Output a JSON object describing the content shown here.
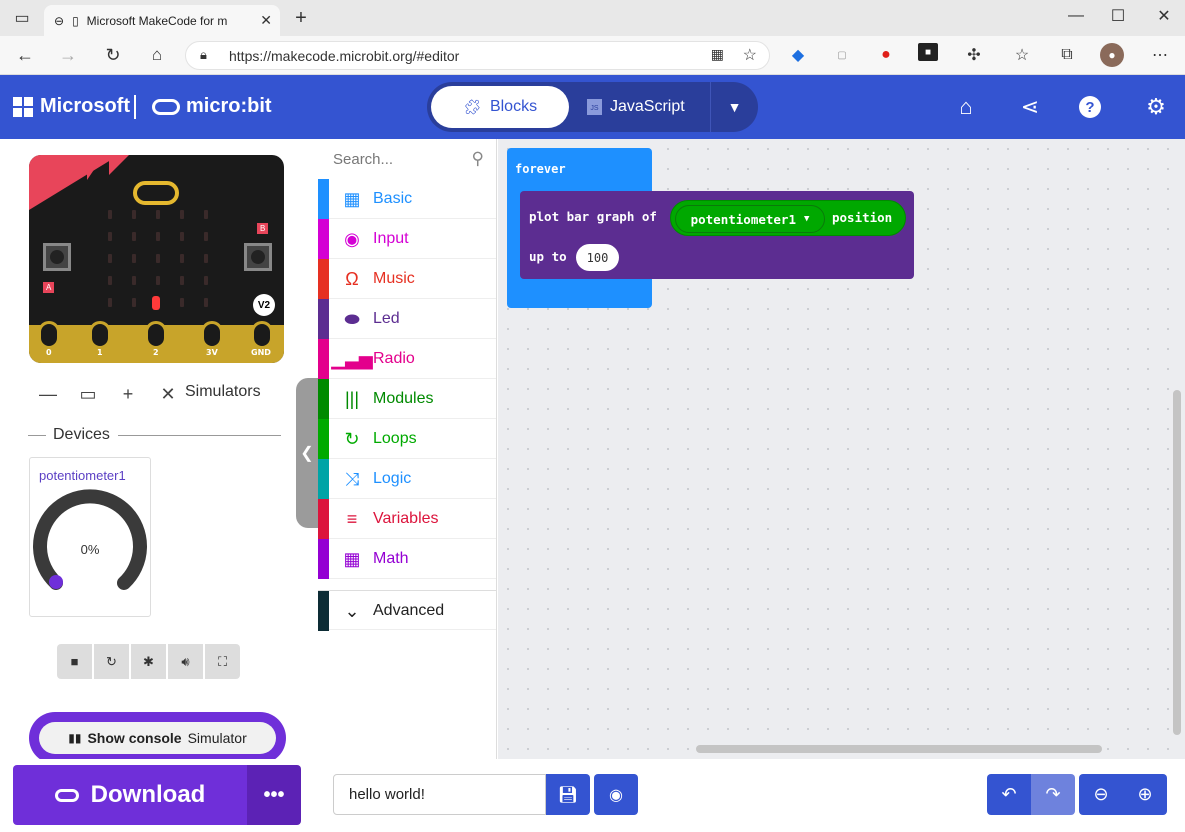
{
  "browser": {
    "tab_title": "Microsoft MakeCode for mi",
    "url": "https://makecode.microbit.org/#editor"
  },
  "header": {
    "brand": "Microsoft",
    "product": "micro:bit",
    "mode_blocks": "Blocks",
    "mode_js": "JavaScript"
  },
  "simulator": {
    "pins": [
      "0",
      "1",
      "2",
      "3V",
      "GND"
    ],
    "button_a": "A",
    "button_b": "B",
    "version_badge": "V2",
    "title": "Simulators",
    "devices_label": "Devices",
    "device_name": "potentiometer1",
    "device_value": "0%",
    "console_show": "Show console",
    "console_target": "Simulator"
  },
  "toolbox": {
    "search_placeholder": "Search...",
    "categories": [
      {
        "label": "Basic",
        "color": "#1e90ff",
        "icon": "grid-icon"
      },
      {
        "label": "Input",
        "color": "#d400d4",
        "icon": "target-icon"
      },
      {
        "label": "Music",
        "color": "#e63022",
        "icon": "headphones-icon"
      },
      {
        "label": "Led",
        "color": "#5c2d91",
        "icon": "toggle-icon"
      },
      {
        "label": "Radio",
        "color": "#e3008c",
        "icon": "signal-icon"
      },
      {
        "label": "Modules",
        "color": "#008a00",
        "icon": "modules-icon"
      },
      {
        "label": "Loops",
        "color": "#00aa00",
        "icon": "loop-icon"
      },
      {
        "label": "Logic",
        "color": "#00a4a6",
        "icon": "shuffle-icon"
      },
      {
        "label": "Variables",
        "color": "#dc143c",
        "icon": "lines-icon"
      },
      {
        "label": "Math",
        "color": "#9400d3",
        "icon": "calculator-icon"
      }
    ],
    "advanced": "Advanced"
  },
  "workspace": {
    "forever_label": "forever",
    "plot_label": "plot bar graph of",
    "sensor_name": "potentiometer1",
    "sensor_suffix": "position",
    "upto_label": "up to",
    "upto_value": "100"
  },
  "footer": {
    "download": "Download",
    "project_name": "hello world!"
  }
}
